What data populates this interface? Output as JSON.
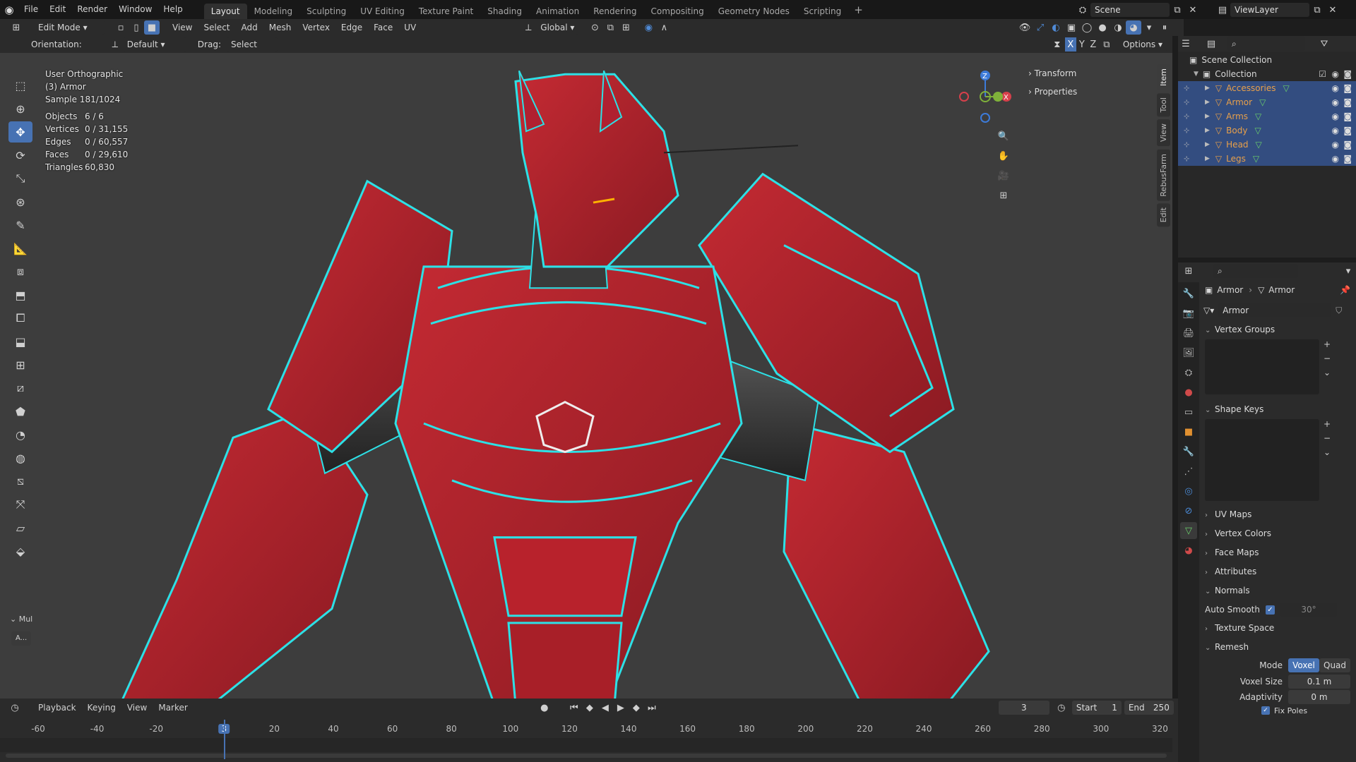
{
  "menus": [
    "File",
    "Edit",
    "Render",
    "Window",
    "Help"
  ],
  "workspaces": [
    "Layout",
    "Modeling",
    "Sculpting",
    "UV Editing",
    "Texture Paint",
    "Shading",
    "Animation",
    "Rendering",
    "Compositing",
    "Geometry Nodes",
    "Scripting"
  ],
  "active_workspace": "Layout",
  "scene_name": "Scene",
  "view_layer": "ViewLayer",
  "header": {
    "mode": "Edit Mode",
    "menus": [
      "View",
      "Select",
      "Add",
      "Mesh",
      "Vertex",
      "Edge",
      "Face",
      "UV"
    ],
    "transform_orientation": "Global",
    "options_label": "Options",
    "orientation_label": "Orientation:",
    "orientation_value": "Default",
    "drag_label": "Drag:",
    "drag_value": "Select Box",
    "axis_labels": [
      "X",
      "Y",
      "Z"
    ]
  },
  "viewport": {
    "view_name": "User Orthographic",
    "object_label": "(3) Armor",
    "sample": "Sample 181/1024",
    "stats": [
      {
        "k": "Objects",
        "v": "6 / 6"
      },
      {
        "k": "Vertices",
        "v": "0 / 31,155"
      },
      {
        "k": "Edges",
        "v": "0 / 60,557"
      },
      {
        "k": "Faces",
        "v": "0 / 29,610"
      },
      {
        "k": "Triangles",
        "v": "60,830"
      }
    ],
    "tool_panel_label": "Mul",
    "tool_panel_btn": "A..."
  },
  "npanel": {
    "sections": [
      "Transform",
      "Properties"
    ],
    "tabs": [
      "Item",
      "Tool",
      "View",
      "RebusFarm",
      "Edit"
    ]
  },
  "outliner": {
    "root": "Scene Collection",
    "collection": "Collection",
    "items": [
      {
        "name": "Accessories",
        "color": "#e8a04a"
      },
      {
        "name": "Armor",
        "color": "#e8a04a"
      },
      {
        "name": "Arms",
        "color": "#e8a04a"
      },
      {
        "name": "Body",
        "color": "#e8a04a"
      },
      {
        "name": "Head",
        "color": "#e8a04a"
      },
      {
        "name": "Legs",
        "color": "#e8a04a"
      }
    ]
  },
  "properties": {
    "breadcrumb_object": "Armor",
    "breadcrumb_data": "Armor",
    "mesh_name": "Armor",
    "sections": {
      "vertex_groups": "Vertex Groups",
      "shape_keys": "Shape Keys",
      "uv_maps": "UV Maps",
      "vertex_colors": "Vertex Colors",
      "face_maps": "Face Maps",
      "attributes": "Attributes",
      "normals": "Normals",
      "texture_space": "Texture Space",
      "remesh": "Remesh"
    },
    "auto_smooth_label": "Auto Smooth",
    "auto_smooth_angle": "30°",
    "remesh_mode_label": "Mode",
    "remesh_modes": [
      "Voxel",
      "Quad"
    ],
    "voxel_size_label": "Voxel Size",
    "voxel_size": "0.1 m",
    "adaptivity_label": "Adaptivity",
    "adaptivity": "0 m",
    "fix_poles": "Fix Poles"
  },
  "timeline": {
    "menus": [
      "Playback",
      "Keying",
      "View",
      "Marker"
    ],
    "current_frame": "3",
    "start_label": "Start",
    "start": "1",
    "end_label": "End",
    "end": "250",
    "ticks": [
      "-60",
      "-40",
      "-20",
      "3",
      "20",
      "40",
      "60",
      "80",
      "100",
      "120",
      "140",
      "160",
      "180",
      "200",
      "220",
      "240",
      "260",
      "280",
      "300",
      "320"
    ]
  }
}
